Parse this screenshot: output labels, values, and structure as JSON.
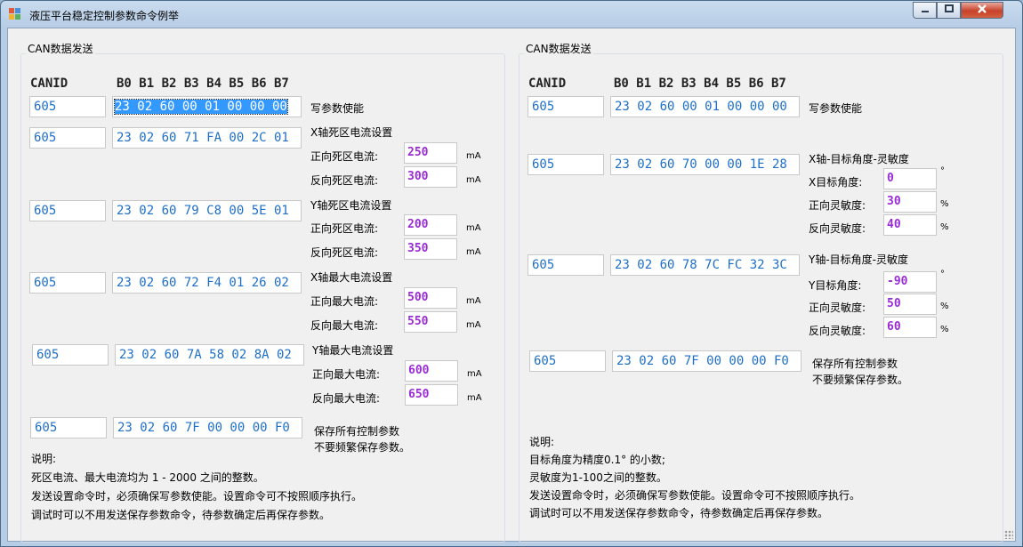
{
  "window": {
    "title": "液压平台稳定控制参数命令例举",
    "minimize": "–",
    "maximize": "□",
    "close": "✕"
  },
  "left": {
    "legend": "CAN数据发送",
    "header": {
      "canid": "CANID",
      "bytes": "B0 B1 B2 B3 B4 B5 B6 B7"
    },
    "rows": [
      {
        "id": "605",
        "data": "23 02 60 00 01 00 00 00",
        "label": "写参数使能"
      },
      {
        "id": "605",
        "data": "23 02 60 71 FA 00 2C 01",
        "label": "X轴死区电流设置",
        "p1": {
          "label": "正向死区电流:",
          "value": "250",
          "unit": "mA"
        },
        "p2": {
          "label": "反向死区电流:",
          "value": "300",
          "unit": "mA"
        }
      },
      {
        "id": "605",
        "data": "23 02 60 79 C8 00 5E 01",
        "label": "Y轴死区电流设置",
        "p1": {
          "label": "正向死区电流:",
          "value": "200",
          "unit": "mA"
        },
        "p2": {
          "label": "反向死区电流:",
          "value": "350",
          "unit": "mA"
        }
      },
      {
        "id": "605",
        "data": "23 02 60 72 F4 01 26 02",
        "label": "X轴最大电流设置",
        "p1": {
          "label": "正向最大电流:",
          "value": "500",
          "unit": "mA"
        },
        "p2": {
          "label": "反向最大电流:",
          "value": "550",
          "unit": "mA"
        }
      },
      {
        "id": "605",
        "data": "23 02 60 7A 58 02 8A 02",
        "label": "Y轴最大电流设置",
        "p1": {
          "label": "正向最大电流:",
          "value": "600",
          "unit": "mA"
        },
        "p2": {
          "label": "反向最大电流:",
          "value": "650",
          "unit": "mA"
        }
      },
      {
        "id": "605",
        "data": "23 02 60 7F 00 00 00 F0",
        "label1": "保存所有控制参数",
        "label2": "不要频繁保存参数。"
      }
    ],
    "notes": [
      "说明:",
      "死区电流、最大电流均为 1 - 2000 之间的整数。",
      "发送设置命令时，必须确保写参数使能。设置命令可不按照顺序执行。",
      "调试时可以不用发送保存参数命令，待参数确定后再保存参数。"
    ]
  },
  "right": {
    "legend": "CAN数据发送",
    "header": {
      "canid": "CANID",
      "bytes": "B0 B1 B2 B3 B4 B5 B6 B7"
    },
    "rows": [
      {
        "id": "605",
        "data": "23 02 60 00 01 00 00 00",
        "label": "写参数使能"
      },
      {
        "id": "605",
        "data": "23 02 60 70 00 00 1E 28",
        "label": "X轴-目标角度-灵敏度",
        "p0": {
          "label": "X目标角度:",
          "value": "0",
          "unit": "°"
        },
        "p1": {
          "label": "正向灵敏度:",
          "value": "30",
          "unit": "%"
        },
        "p2": {
          "label": "反向灵敏度:",
          "value": "40",
          "unit": "%"
        }
      },
      {
        "id": "605",
        "data": "23 02 60 78 7C FC 32 3C",
        "label": "Y轴-目标角度-灵敏度",
        "p0": {
          "label": "Y目标角度:",
          "value": "-90",
          "unit": "°"
        },
        "p1": {
          "label": "正向灵敏度:",
          "value": "50",
          "unit": "%"
        },
        "p2": {
          "label": "反向灵敏度:",
          "value": "60",
          "unit": "%"
        }
      },
      {
        "id": "605",
        "data": "23 02 60 7F 00 00 00 F0",
        "label1": "保存所有控制参数",
        "label2": "不要频繁保存参数。"
      }
    ],
    "notes": [
      "说明:",
      "目标角度为精度0.1° 的小数;",
      "灵敏度为1-100之间的整数。",
      "发送设置命令时，必须确保写参数使能。设置命令可不按照顺序执行。",
      "调试时可以不用发送保存参数命令，待参数确定后再保存参数。"
    ]
  }
}
